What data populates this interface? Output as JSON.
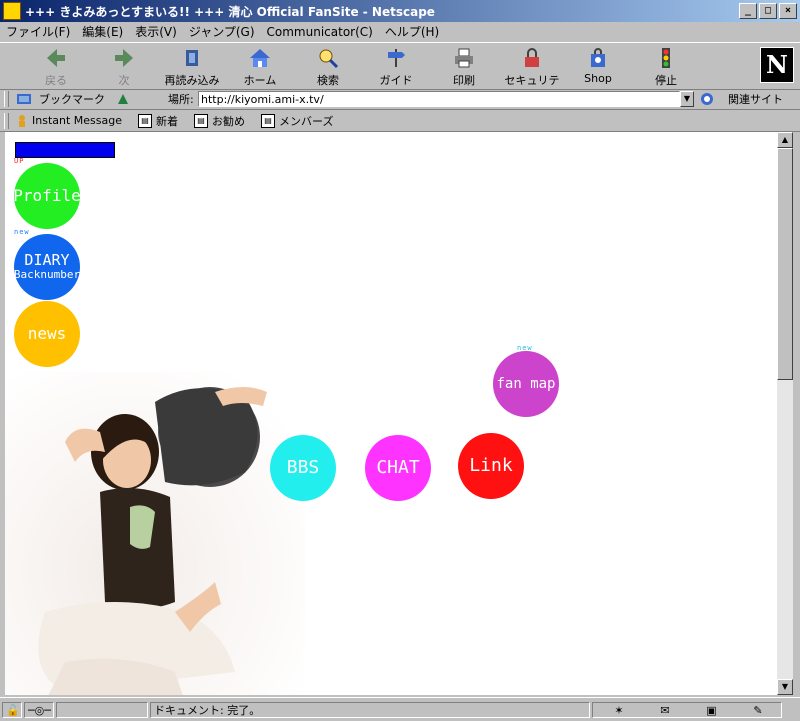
{
  "window": {
    "title": "+++ きよみあっとすまいる!! +++ 清心 Official FanSite - Netscape",
    "buttons": {
      "minimize": "_",
      "maximize": "□",
      "close": "×"
    }
  },
  "menu": [
    "ファイル(F)",
    "編集(E)",
    "表示(V)",
    "ジャンプ(G)",
    "Communicator(C)",
    "ヘルプ(H)"
  ],
  "toolbar": {
    "back": "戻る",
    "forward": "次",
    "reload": "再読み込み",
    "home": "ホーム",
    "search": "検索",
    "guide": "ガイド",
    "print": "印刷",
    "security": "セキュリティ",
    "shop": "Shop",
    "stop": "停止",
    "logo": "N"
  },
  "location": {
    "bookmarks": "ブックマーク",
    "label": "場所:",
    "url": "http://kiyomi.ami-x.tv/",
    "related": "関連サイト"
  },
  "personal": [
    "Instant Message",
    "新着",
    "お勧め",
    "メンバーズ"
  ],
  "page": {
    "up_tag": "UP",
    "new_tag_diary": "new",
    "new_tag_fanmap": "new",
    "profile": "Profile",
    "diary_line1": "DIARY",
    "diary_line2": "Backnumber",
    "news": "news",
    "fanmap": "fan map",
    "bbs": "BBS",
    "chat": "CHAT",
    "link": "Link"
  },
  "colors": {
    "profile": "#22ee22",
    "diary": "#1166ee",
    "news": "#ffc000",
    "fanmap": "#cc44cc",
    "bbs": "#22eeee",
    "chat": "#ff33ff",
    "link": "#ff1111",
    "banner": "#0000ee"
  },
  "status": {
    "text": "ドキュメント: 完了。"
  }
}
